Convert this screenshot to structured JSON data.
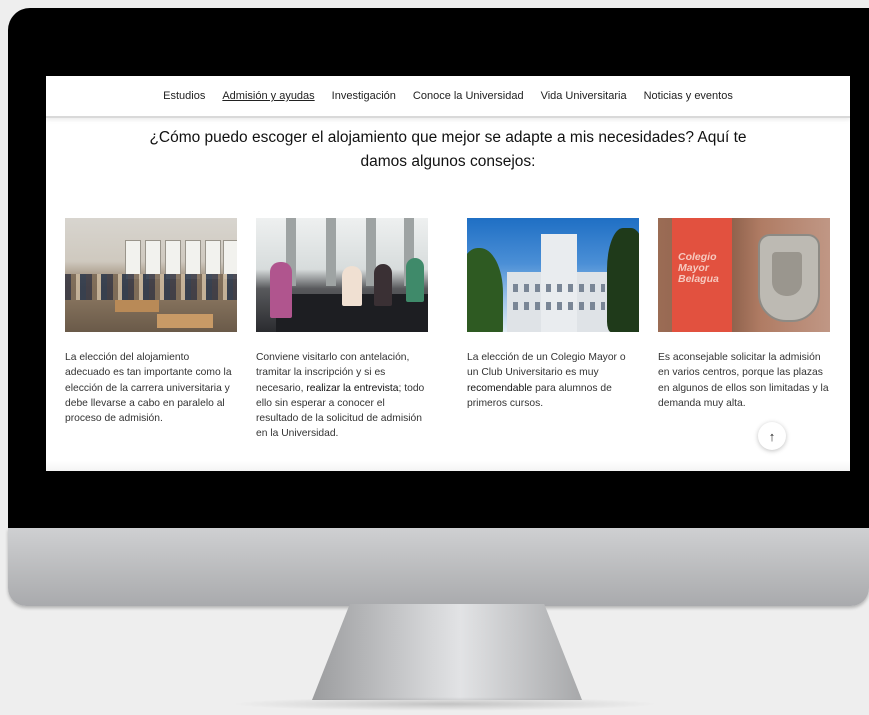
{
  "nav": {
    "items": [
      {
        "label": "Estudios",
        "active": false
      },
      {
        "label": "Admisión y ayudas",
        "active": true
      },
      {
        "label": "Investigación",
        "active": false
      },
      {
        "label": "Conoce la Universidad",
        "active": false
      },
      {
        "label": "Vida Universitaria",
        "active": false
      },
      {
        "label": "Noticias y eventos",
        "active": false
      }
    ]
  },
  "heading": {
    "line1": "¿Cómo puedo escoger el alojamiento que mejor se adapte a mis necesidades? Aquí te",
    "line2": "damos algunos consejos:"
  },
  "cards": [
    {
      "image_icon": "lounge-photo",
      "text_a": "La elección del alojamiento adecuado es tan importante como la elección de la carrera universitaria y debe llevarse a cabo en paralelo al proceso de admisión.",
      "text_b": ""
    },
    {
      "image_icon": "study-room-photo",
      "text_a": "Conviene visitarlo con antelación, tramitar la inscripción y si es necesario, ",
      "text_b": "realizar la entrevista",
      "text_c": "; todo ello sin esperar a conocer el resultado de la solicitud de admisión en la Universidad."
    },
    {
      "image_icon": "building-photo",
      "text_a": "La elección de un Colegio Mayor o un Club Universitario es muy ",
      "text_b": "recomendable",
      "text_c": " para alumnos de primeros cursos."
    },
    {
      "image_icon": "colegio-sign-photo",
      "sign_text": "Colegio Mayor Belagua",
      "text_a": "Es aconsejable solicitar la admisión en varios centros, porque las plazas en algunos de ellos son limitadas y la demanda muy alta.",
      "text_b": ""
    }
  ],
  "scroll_top": {
    "icon": "arrow-up-icon",
    "glyph": "↑"
  }
}
